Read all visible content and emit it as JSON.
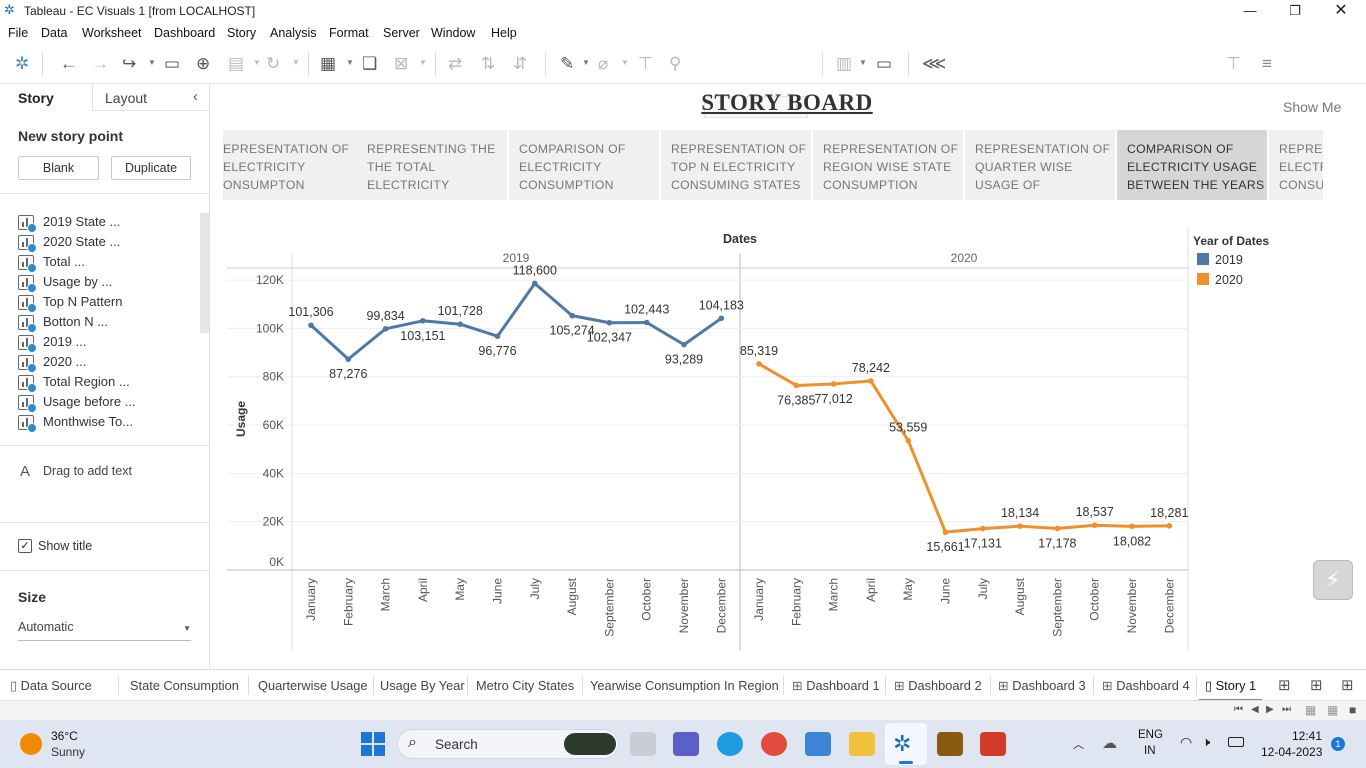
{
  "window": {
    "title": "Tableau - EC Visuals 1 [from LOCALHOST]"
  },
  "menu": [
    "File",
    "Data",
    "Worksheet",
    "Dashboard",
    "Story",
    "Analysis",
    "Format",
    "Server",
    "Window",
    "Help"
  ],
  "toolbar": {
    "show_me": "Show Me"
  },
  "left_panel": {
    "tab_story": "Story",
    "tab_layout": "Layout",
    "new_story_point": "New story point",
    "blank_button": "Blank",
    "duplicate_button": "Duplicate",
    "sheets": [
      "2019 State ...",
      "2020 State ...",
      "Total ...",
      "Usage by ...",
      "Top N Pattern",
      "Botton N ...",
      "2019 ...",
      "2020 ...",
      "Total Region ...",
      "Usage before ...",
      "Monthwise To..."
    ],
    "drag_text": "Drag to add text",
    "text_glyph": "A",
    "show_title": "Show title",
    "size_heading": "Size",
    "size_value": "Automatic"
  },
  "story": {
    "title": "STORY BOARD",
    "points": [
      "EPRESENTATION OF ELECTRICITY ONSUMPTON",
      "REPRESENTING THE THE TOTAL ELECTRICITY",
      "COMPARISON OF ELECTRICITY CONSUMPTION",
      "REPRESENTATION OF TOP N ELECTRICITY CONSUMING STATES",
      "REPRESENTATION OF REGION WISE STATE CONSUMPTION",
      "REPRESENTATION OF QUARTER WISE USAGE OF",
      "COMPARISON OF ELECTRICITY USAGE BETWEEN THE YEARS",
      "REPRESENTA ELECTRICITY CONSUMPTI"
    ],
    "active_index": 6
  },
  "chart_data": {
    "type": "line",
    "title": "Dates",
    "ylabel": "Usage",
    "ylim": [
      0,
      125000
    ],
    "y_ticks": [
      "0K",
      "20K",
      "40K",
      "60K",
      "80K",
      "100K",
      "120K"
    ],
    "panes": [
      "2019",
      "2020"
    ],
    "categories": [
      "January",
      "February",
      "March",
      "April",
      "May",
      "June",
      "July",
      "August",
      "September",
      "October",
      "November",
      "December"
    ],
    "legend_title": "Year of Dates",
    "legend_position": "right",
    "series": [
      {
        "name": "2019",
        "color": "#4e79a7",
        "values": [
          101306,
          87276,
          99834,
          103151,
          101728,
          96776,
          118600,
          105274,
          102347,
          102443,
          93289,
          104183
        ],
        "labels": [
          "101,306",
          "87,276",
          "99,834",
          "103,151",
          "101,728",
          "96,776",
          "118,600",
          "105,274",
          "102,347",
          "102,443",
          "93,289",
          "104,183"
        ]
      },
      {
        "name": "2020",
        "color": "#f28e2b",
        "values": [
          85319,
          76385,
          77012,
          78242,
          53559,
          15661,
          17131,
          18134,
          17178,
          18537,
          18082,
          18281
        ],
        "labels": [
          "85,319",
          "76,385",
          "77,012",
          "78,242",
          "53,559",
          "15,661",
          "17,131",
          "18,134",
          "17,178",
          "18,537",
          "18,082",
          "18,281"
        ]
      }
    ]
  },
  "sheet_tabs": [
    "Data Source",
    "State Consumption",
    "Quarterwise Usage",
    "Usage By Year",
    "Metro City States",
    "Yearwise Consumption In Region",
    "Dashboard 1",
    "Dashboard 2",
    "Dashboard 3",
    "Dashboard 4",
    "Story 1"
  ],
  "taskbar": {
    "weather_temp": "36°C",
    "weather_desc": "Sunny",
    "search": "Search",
    "lang1": "ENG",
    "lang2": "IN",
    "time": "12:41",
    "date": "12-04-2023",
    "notif_count": "1"
  }
}
